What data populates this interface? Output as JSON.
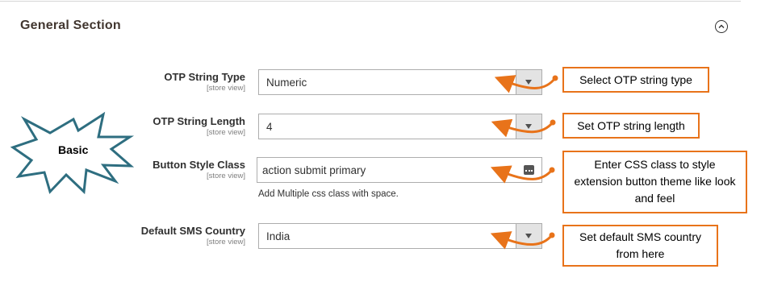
{
  "section": {
    "title": "General Section",
    "collapse_icon": "chevron-up-circle-icon"
  },
  "fields": {
    "otp_type": {
      "label": "OTP String Type",
      "scope": "[store view]",
      "value": "Numeric"
    },
    "otp_length": {
      "label": "OTP String Length",
      "scope": "[store view]",
      "value": "4"
    },
    "button_class": {
      "label": "Button Style Class",
      "scope": "[store view]",
      "value": "action submit primary",
      "note": "Add Multiple css class with space."
    },
    "sms_country": {
      "label": "Default SMS Country",
      "scope": "[store view]",
      "value": "India"
    }
  },
  "badge": {
    "text": "Basic"
  },
  "callouts": {
    "otp_type": "Select OTP string type",
    "otp_length": "Set OTP string length",
    "button_class": "Enter CSS class to style extension button theme like look and feel",
    "sms_country": "Set default SMS country from here"
  },
  "colors": {
    "callout_border": "#e8731a",
    "badge_outline": "#2e6e80"
  }
}
